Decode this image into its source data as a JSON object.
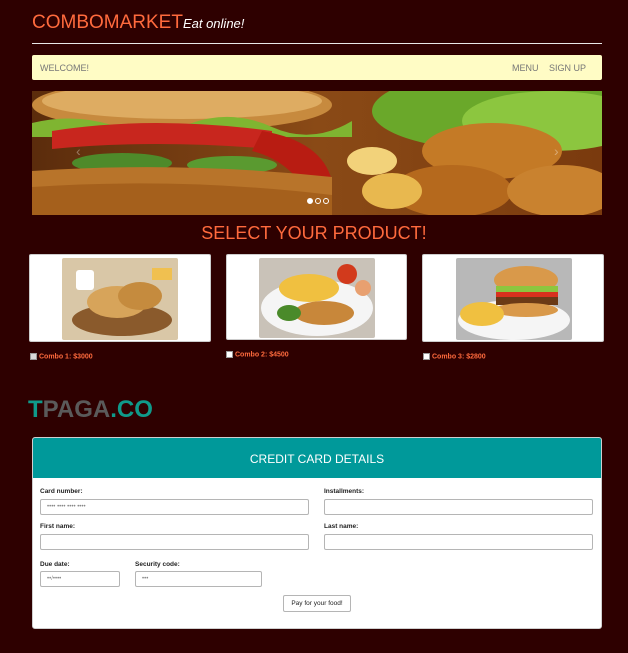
{
  "header": {
    "brand": "COMBOMARKET",
    "tagline": "Eat online!"
  },
  "nav": {
    "welcome": "WELCOME!",
    "menu": "MENU",
    "signup": "SIGN UP"
  },
  "section_title": "SELECT YOUR PRODUCT!",
  "products": [
    {
      "label": "Combo 1: $3000",
      "checked": true
    },
    {
      "label": "Combo 2: $4500",
      "checked": false
    },
    {
      "label": "Combo 3: $2800",
      "checked": false
    }
  ],
  "logo": {
    "part1": "T",
    "part2": "PAGA",
    "part3": ".CO"
  },
  "credit_card": {
    "title": "CREDIT CARD DETAILS",
    "card_number_label": "Card number:",
    "card_number_placeholder": "•••• •••• •••• ••••",
    "installments_label": "Installments:",
    "first_name_label": "First name:",
    "last_name_label": "Last name:",
    "due_date_label": "Due date:",
    "due_date_placeholder": "••/••••",
    "security_code_label": "Security code:",
    "security_code_placeholder": "•••",
    "pay_button": "Pay for your food!"
  },
  "colors": {
    "background": "#2e0000",
    "accent": "#ff6a3d",
    "cc_header": "#00999a",
    "navbar": "#fffcc5"
  }
}
